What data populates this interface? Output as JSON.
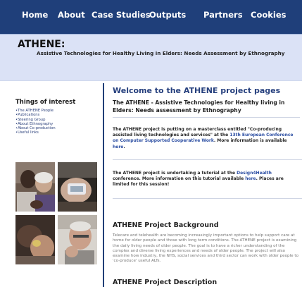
{
  "nav": {
    "items": [
      "Home",
      "About",
      "Case Studies",
      "Outputs",
      "Partners",
      "Cookies"
    ]
  },
  "header": {
    "title": "ATHENE:",
    "subtitle": "Assistive Technologies for Healthy Living in Elders: Needs Assessment by Ethnography"
  },
  "sidebar": {
    "heading": "Things of interest",
    "links": [
      "The ATHENE People",
      "Publications",
      "Steering Group",
      "About Ethnography",
      "About Co-production",
      "Useful links"
    ]
  },
  "main": {
    "welcome_heading": "Welcome to the ATHENE project pages",
    "welcome_sub": "The ATHENE - Assistive Technologies for Healthy living in Elders: Needs assessment by Ethnography",
    "news1": {
      "pre": "The ATHENE project is putting on a masterclass entitled \"Co-producing assisted living technologies and services\" at the ",
      "link1": "13th European Conference on Computer Supported Cooperative Work",
      "mid": ". More information is available ",
      "link2": "here",
      "post": "."
    },
    "news2": {
      "pre": "The ATHENE project is undertaking a tutorial at the ",
      "link1": "Design4Health",
      "mid": " conference. More information on this tutorial available ",
      "link2": "here",
      "post": ". Places are limited for this session!"
    },
    "background_heading": "ATHENE Project Background",
    "background_text": "Telecare and telehealth are becoming increasingly important options to help support care at home for older people and those with long term conditions. The ATHENE project is examining the daily living needs of older people. The goal is to have a richer understanding of the complex and diverse living experiences and needs of older people. The project will also examine how industry, the NHS, social services and third sector can work with older people to 'co-produce' useful ALTs.",
    "description_heading": "ATHENE Project Description"
  },
  "colors": {
    "nav_bg": "#1f3f7a",
    "banner_bg": "#dbe2f6",
    "heading_blue": "#253f7d",
    "link_blue": "#2d4fa3"
  }
}
